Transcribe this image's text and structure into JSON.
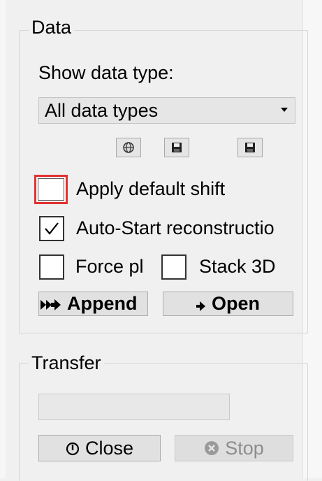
{
  "data_group": {
    "title": "Data",
    "show_data_type_label": "Show data type:",
    "data_type_select": {
      "selected": "All data types"
    },
    "icon_buttons": [
      {
        "icon": "globe-icon"
      },
      {
        "icon": "save-icon"
      },
      {
        "icon": "save-icon"
      }
    ],
    "checkboxes": {
      "apply_default_shift": {
        "label": "Apply default shift",
        "checked": false,
        "highlighted": true
      },
      "auto_start": {
        "label": "Auto-Start reconstructio",
        "checked": true
      },
      "force": {
        "label": "Force pl",
        "checked": false
      },
      "stack_3d": {
        "label": "Stack 3D",
        "checked": false
      }
    },
    "append_button": {
      "label": "Append",
      "icon": "double-arrow-right-icon"
    },
    "open_button": {
      "label": "Open",
      "icon": "arrow-right-icon"
    }
  },
  "transfer_group": {
    "title": "Transfer",
    "progress": 0,
    "close_button": {
      "label": "Close",
      "icon": "power-icon"
    },
    "stop_button": {
      "label": "Stop",
      "icon": "stop-icon",
      "disabled": true
    }
  },
  "colors": {
    "highlight": "#e23232",
    "panel_bg": "#f0f0f0"
  }
}
